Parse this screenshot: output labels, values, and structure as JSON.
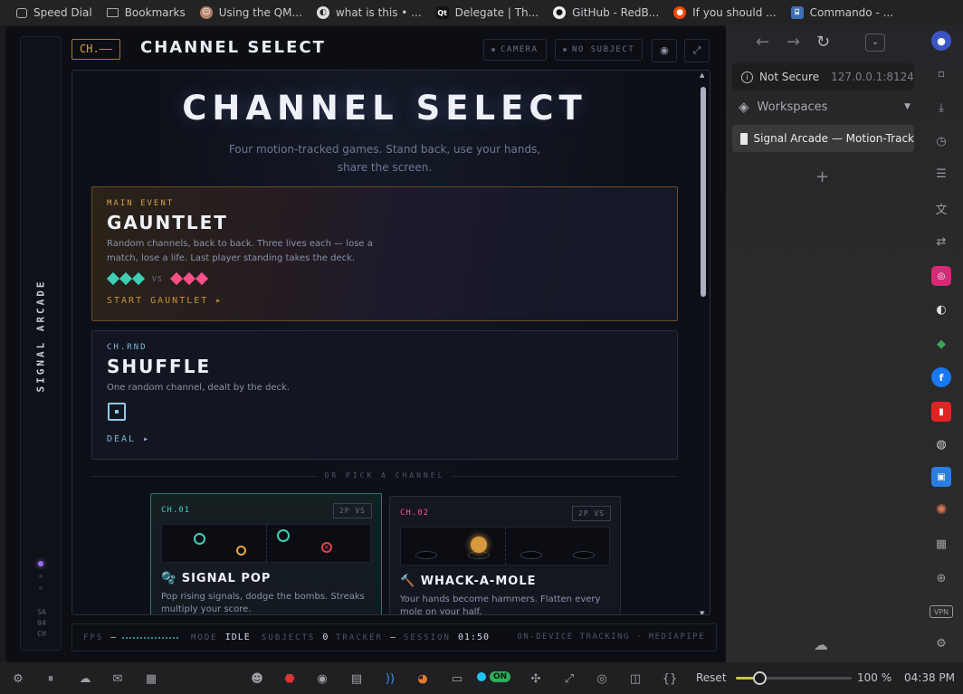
{
  "bookmarks": [
    {
      "label": "Speed Dial",
      "icon": "speed-dial-icon"
    },
    {
      "label": "Bookmarks",
      "icon": "folder-icon"
    },
    {
      "label": "Using the QM...",
      "icon": "avatar-icon"
    },
    {
      "label": "what is this • ...",
      "icon": "site-icon"
    },
    {
      "label": "Delegate | Th...",
      "icon": "qt-icon"
    },
    {
      "label": "GitHub - RedB...",
      "icon": "github-icon"
    },
    {
      "label": "If you should ...",
      "icon": "reddit-icon"
    },
    {
      "label": "Commando - ...",
      "icon": "commando-icon"
    }
  ],
  "app": {
    "channel_tag": "CH.——",
    "title": "CHANNEL SELECT",
    "pills": [
      "CAMERA",
      "NO SUBJECT"
    ],
    "rail_brand": "SIGNAL ARCADE",
    "rail_sub": [
      "SA",
      "04",
      "CH"
    ],
    "colors": {
      "accent_gold": "#d6a04c",
      "accent_teal": "#3ecfb5",
      "accent_pink": "#ff4f8b",
      "accent_purple": "#9b6ee8"
    }
  },
  "hero": {
    "title": "CHANNEL SELECT",
    "subtitle": "Four motion-tracked games. Stand back, use your hands, share the screen."
  },
  "gauntlet": {
    "eyebrow": "MAIN EVENT",
    "title": "GAUNTLET",
    "text": "Random channels, back to back. Three lives each — lose a match, lose a life. Last player standing takes the deck.",
    "vs": "VS",
    "lives_each": 3,
    "cta": "START GAUNTLET ▸"
  },
  "shuffle": {
    "eyebrow": "CH.RND",
    "title": "SHUFFLE",
    "text": "One random channel, dealt by the deck.",
    "cta": "DEAL ▸"
  },
  "divider": "OR PICK A CHANNEL",
  "games": [
    {
      "tag": "CH.01",
      "badge": "2P VS",
      "title": "🫧 SIGNAL POP",
      "text": "Pop rising signals, dodge the bombs. Streaks multiply your score."
    },
    {
      "tag": "CH.02",
      "badge": "2P VS",
      "title": "🔨 WHACK-A-MOLE",
      "text": "Your hands become hammers. Flatten every mole on your half."
    }
  ],
  "status": {
    "fps_label": "FPS",
    "fps_value": "—",
    "mode_label": "MODE",
    "mode_value": "IDLE",
    "subjects_label": "SUBJECTS",
    "subjects_value": "0",
    "tracker_label": "TRACKER",
    "tracker_value": "—",
    "session_label": "SESSION",
    "session_value": "01:50",
    "footer": "ON-DEVICE TRACKING · MEDIAPIPE"
  },
  "sidebar": {
    "security": "Not Secure",
    "url": "127.0.0.1:8124",
    "workspaces": "Workspaces",
    "active_tab": "Signal Arcade — Motion-Track",
    "new_tab": "+"
  },
  "bottom": {
    "reset": "Reset",
    "zoom": "100 %",
    "zoom_level": 0.2,
    "time": "04:38 PM",
    "toggle": "ON"
  }
}
